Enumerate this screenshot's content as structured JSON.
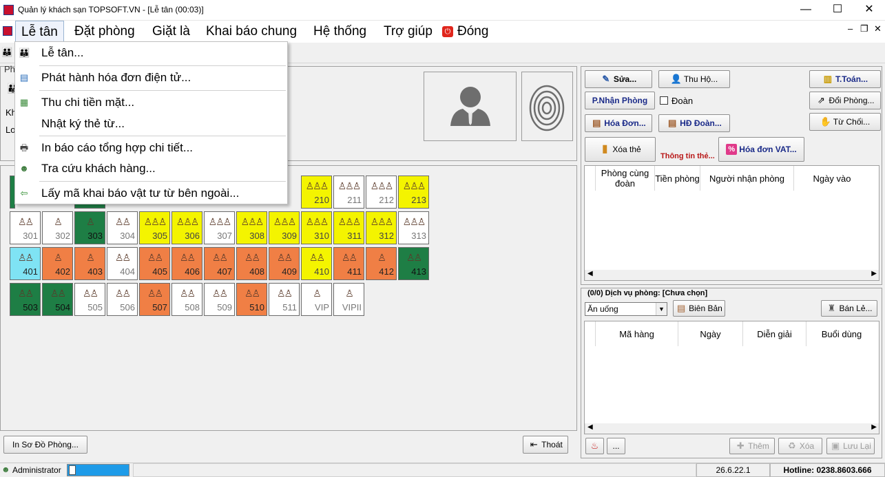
{
  "window": {
    "title": "Quản lý khách sạn TOPSOFT.VN - [Lễ tân (00:03)]",
    "min": "—",
    "max": "☐",
    "close": "✕"
  },
  "menubar": {
    "items": [
      "Lễ tân",
      "Đặt phòng",
      "Giặt là",
      "Khai báo chung",
      "Hệ thống",
      "Trợ giúp",
      "Đóng"
    ],
    "mdi_min": "–",
    "mdi_restore": "❐",
    "mdi_close": "✕"
  },
  "dropdown": {
    "items": [
      "Lễ tân...",
      "Phát hành hóa đơn điện tử...",
      "Thu chi tiền mặt...",
      "Nhật ký thẻ từ...",
      "In báo cáo tổng hợp chi tiết...",
      "Tra cứu khách hàng...",
      "Lấy mã khai báo vật tư từ bên ngoài..."
    ]
  },
  "left_labels": {
    "ph": "Ph",
    "kh": "Kh",
    "lo": "Lo"
  },
  "rooms": [
    {
      "no": "210",
      "color": "yellow",
      "people": "3"
    },
    {
      "no": "211",
      "color": "white",
      "people": "3"
    },
    {
      "no": "212",
      "color": "white",
      "people": "3"
    },
    {
      "no": "213",
      "color": "yellow",
      "people": "3"
    },
    {
      "no": "301",
      "color": "white",
      "people": "2"
    },
    {
      "no": "302",
      "color": "white",
      "people": "1"
    },
    {
      "no": "303",
      "color": "green",
      "people": "1"
    },
    {
      "no": "304",
      "color": "white",
      "people": "2"
    },
    {
      "no": "305",
      "color": "yellow",
      "people": "3"
    },
    {
      "no": "306",
      "color": "yellow",
      "people": "3"
    },
    {
      "no": "307",
      "color": "white",
      "people": "3"
    },
    {
      "no": "308",
      "color": "yellow",
      "people": "3"
    },
    {
      "no": "309",
      "color": "yellow",
      "people": "3"
    },
    {
      "no": "310",
      "color": "yellow",
      "people": "3"
    },
    {
      "no": "311",
      "color": "yellow",
      "people": "3"
    },
    {
      "no": "312",
      "color": "yellow",
      "people": "3"
    },
    {
      "no": "313",
      "color": "white",
      "people": "3"
    },
    {
      "no": "401",
      "color": "cyan",
      "people": "2"
    },
    {
      "no": "402",
      "color": "orange",
      "people": "1"
    },
    {
      "no": "403",
      "color": "orange",
      "people": "1"
    },
    {
      "no": "404",
      "color": "white",
      "people": "2"
    },
    {
      "no": "405",
      "color": "orange",
      "people": "2"
    },
    {
      "no": "406",
      "color": "orange",
      "people": "2"
    },
    {
      "no": "407",
      "color": "orange",
      "people": "2"
    },
    {
      "no": "408",
      "color": "orange",
      "people": "2"
    },
    {
      "no": "409",
      "color": "orange",
      "people": "2"
    },
    {
      "no": "410",
      "color": "yellow",
      "people": "2"
    },
    {
      "no": "411",
      "color": "orange",
      "people": "2"
    },
    {
      "no": "412",
      "color": "orange",
      "people": "1"
    },
    {
      "no": "413",
      "color": "green",
      "people": "2"
    },
    {
      "no": "503",
      "color": "green",
      "people": "2"
    },
    {
      "no": "504",
      "color": "green",
      "people": "2"
    },
    {
      "no": "505",
      "color": "white",
      "people": "2"
    },
    {
      "no": "506",
      "color": "white",
      "people": "2"
    },
    {
      "no": "507",
      "color": "orange",
      "people": "2"
    },
    {
      "no": "508",
      "color": "white",
      "people": "2"
    },
    {
      "no": "509",
      "color": "white",
      "people": "2"
    },
    {
      "no": "510",
      "color": "orange",
      "people": "2"
    },
    {
      "no": "511",
      "color": "white",
      "people": "2"
    },
    {
      "no": "VIP",
      "color": "white",
      "people": "1"
    },
    {
      "no": "VIPII",
      "color": "white",
      "people": "1"
    }
  ],
  "right": {
    "btn_sua": "Sửa...",
    "btn_thuho": "Thu Hộ...",
    "btn_ttoan": "T.Toán...",
    "btn_pnhanphong": "P.Nhận Phòng",
    "chk_doan": "Đoàn",
    "btn_doiphong": "Đổi Phòng...",
    "btn_hoadon": "Hóa Đơn...",
    "btn_hddoan": "HĐ Đoàn...",
    "btn_tuchoi": "Từ Chối...",
    "btn_xoathe": "Xóa thẻ",
    "lbl_thongtinthe": "Thông tin thẻ...",
    "btn_hoadonvat": "Hóa đơn VAT...",
    "grid1_headers": [
      "Phòng cùng đoàn",
      "Tiền phòng",
      "Người nhận phòng",
      "Ngày vào"
    ],
    "service_label": "(0/0) Dịch vụ phòng: [Chưa chọn]",
    "service_select": "Ăn uống",
    "btn_bienban": "Biên Bản",
    "btn_banle": "Bán Lẻ...",
    "grid2_headers": [
      "Mã hàng",
      "Ngày",
      "Diễn giải",
      "Buổi dùng"
    ],
    "btn_dots": "...",
    "btn_them": "Thêm",
    "btn_xoa": "Xóa",
    "btn_luulai": "Lưu Lại"
  },
  "bottom": {
    "btn_inso": "In Sơ Đồ Phòng...",
    "btn_thoat": "Thoát"
  },
  "status": {
    "user": "Administrator",
    "version": "26.6.22.1",
    "hotline": "Hotline: 0238.8603.666"
  },
  "colors": {
    "yellow": "#f4f400",
    "orange": "#f07f45",
    "green": "#1e7e45",
    "cyan": "#7fe3f4",
    "status_blue": "#1e9be8"
  }
}
